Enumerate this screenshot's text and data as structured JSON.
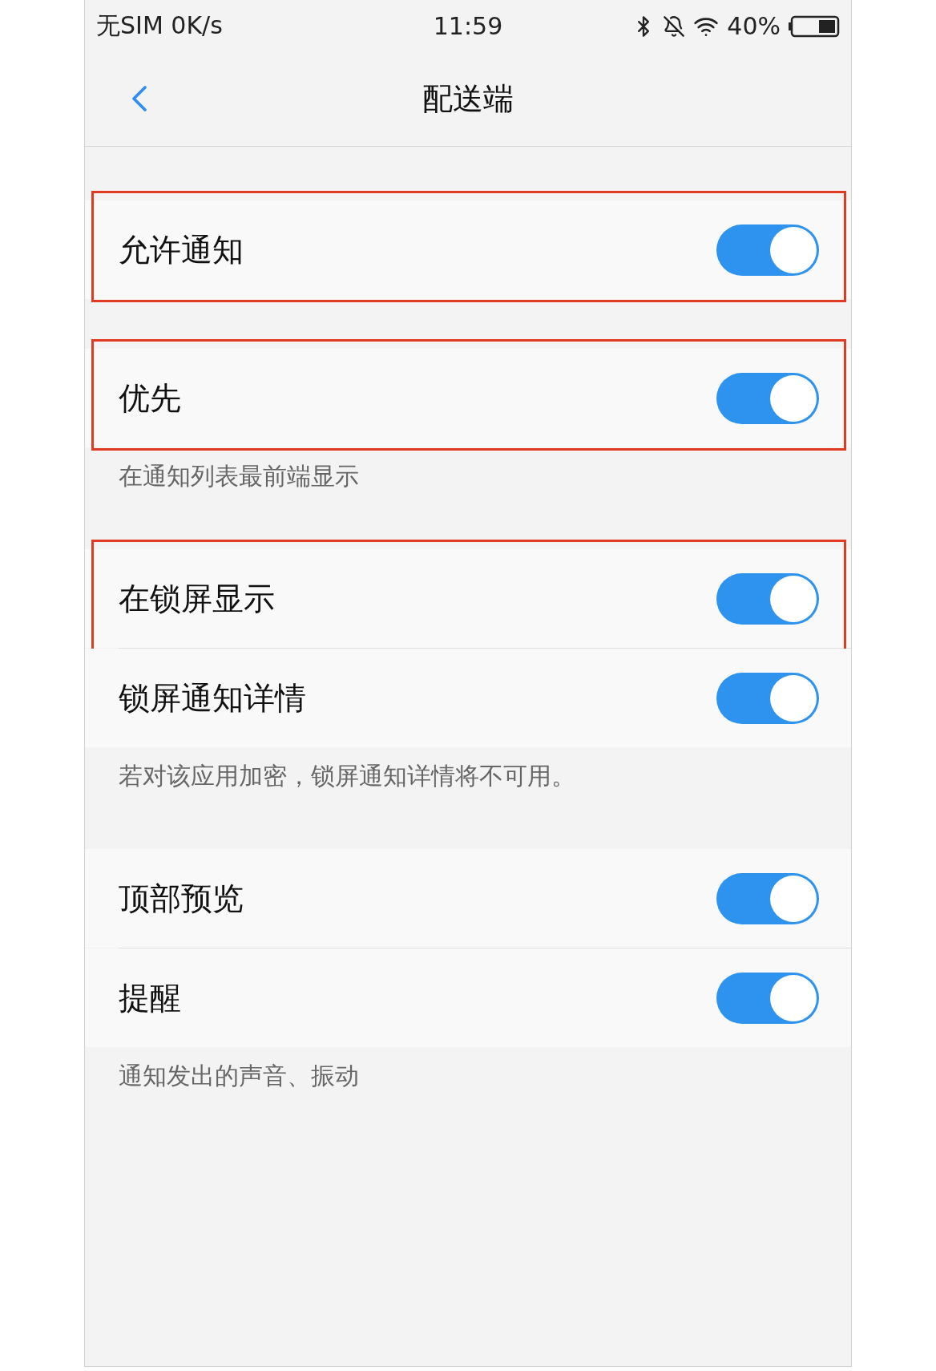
{
  "status_bar": {
    "carrier": "无SIM 0K/s",
    "time": "11:59",
    "battery": "40%"
  },
  "nav": {
    "title": "配送端"
  },
  "sections": [
    {
      "rows": [
        {
          "label": "允许通知",
          "on": true,
          "highlighted": true
        }
      ]
    },
    {
      "rows": [
        {
          "label": "优先",
          "on": true,
          "highlighted": true
        }
      ],
      "footnote": "在通知列表最前端显示"
    },
    {
      "rows": [
        {
          "label": "在锁屏显示",
          "on": true,
          "highlighted": true
        },
        {
          "label": "锁屏通知详情",
          "on": true,
          "highlighted": false
        }
      ],
      "footnote": "若对该应用加密，锁屏通知详情将不可用。"
    },
    {
      "rows": [
        {
          "label": "顶部预览",
          "on": true,
          "highlighted": false
        },
        {
          "label": "提醒",
          "on": true,
          "highlighted": false
        }
      ],
      "footnote": "通知发出的声音、振动"
    }
  ]
}
